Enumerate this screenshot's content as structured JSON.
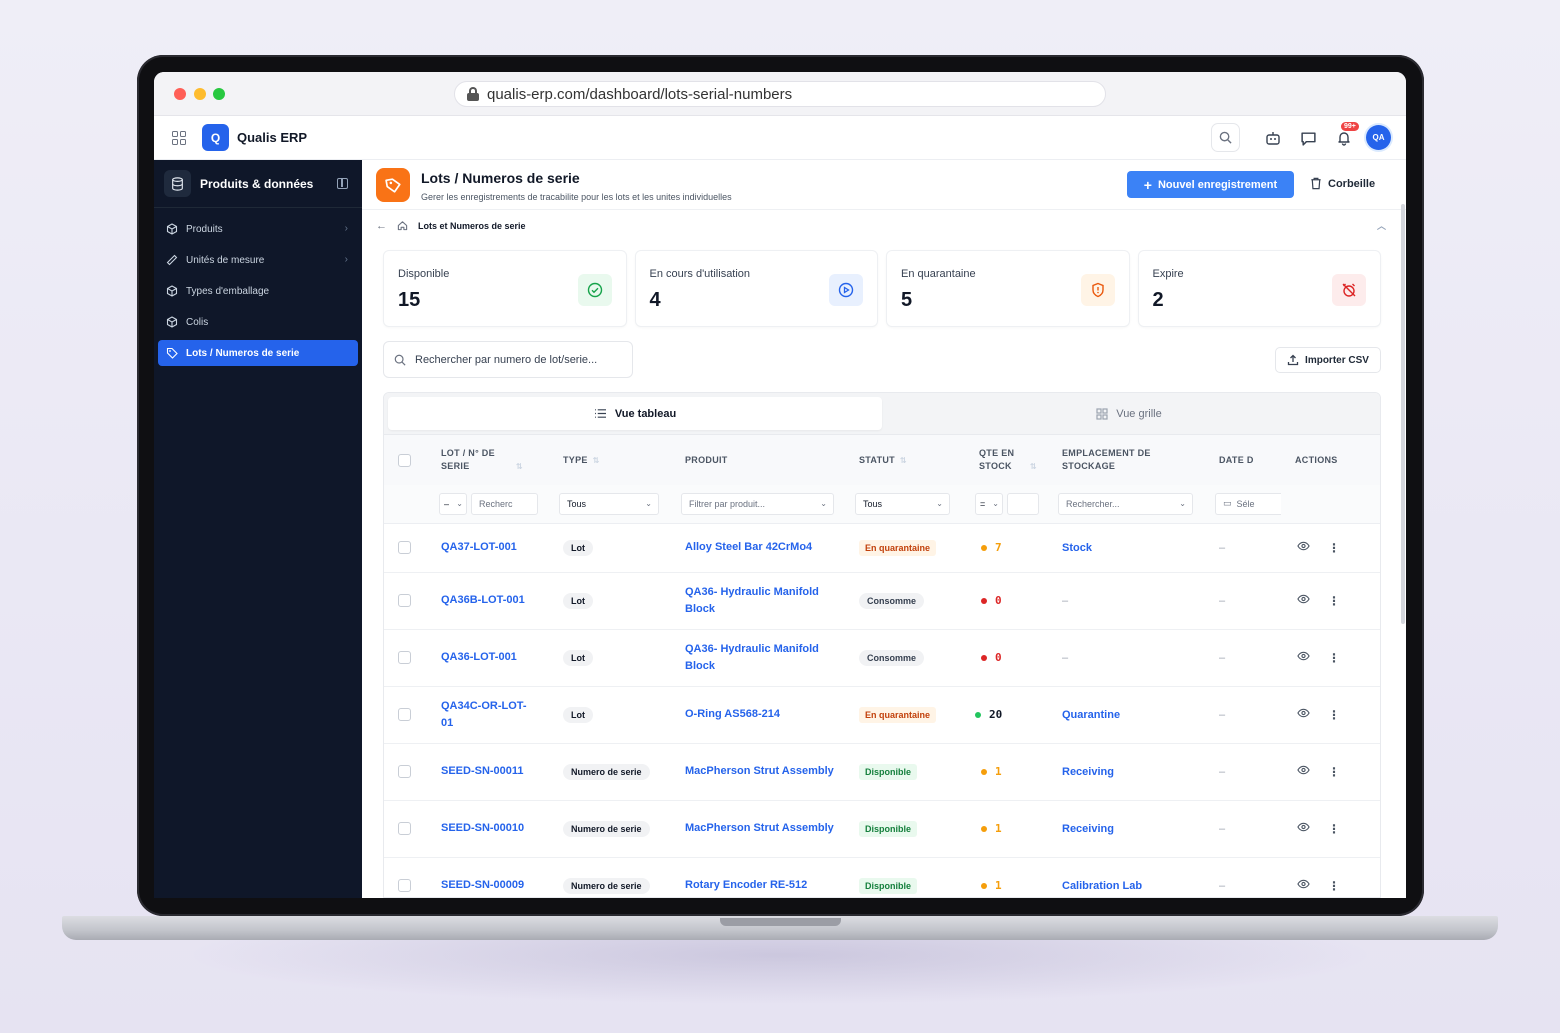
{
  "browser": {
    "url": "qualis-erp.com/dashboard/lots-serial-numbers"
  },
  "header": {
    "logo_letter": "Q",
    "app_name": "Qualis ERP",
    "notif_badge": "99+",
    "avatar_initials": "QA"
  },
  "sidebar": {
    "section_title": "Produits & données",
    "items": [
      {
        "label": "Produits",
        "has_chevron": true
      },
      {
        "label": "Unités de mesure",
        "has_chevron": true
      },
      {
        "label": "Types d'emballage",
        "has_chevron": false
      },
      {
        "label": "Colis",
        "has_chevron": false
      },
      {
        "label": "Lots / Numeros de serie",
        "has_chevron": false,
        "active": true
      }
    ]
  },
  "page": {
    "title": "Lots / Numeros de serie",
    "subtitle": "Gerer les enregistrements de tracabilite pour les lots et les unites individuelles",
    "new_button": "Nouvel enregistrement",
    "trash_button": "Corbeille",
    "breadcrumb": "Lots et Numeros de serie"
  },
  "stats": [
    {
      "label": "Disponible",
      "value": "15",
      "icon": "check-circle-icon",
      "color": "#16a34a",
      "bg": "#e9f9ee"
    },
    {
      "label": "En cours d'utilisation",
      "value": "4",
      "icon": "play-circle-icon",
      "color": "#2563eb",
      "bg": "#e8f0fe"
    },
    {
      "label": "En quarantaine",
      "value": "5",
      "icon": "shield-alert-icon",
      "color": "#ea580c",
      "bg": "#fff4e6"
    },
    {
      "label": "Expire",
      "value": "2",
      "icon": "alarm-off-icon",
      "color": "#dc2626",
      "bg": "#fdecec"
    }
  ],
  "search": {
    "placeholder": "Rechercher par numero de lot/serie..."
  },
  "import_button": "Importer CSV",
  "views": {
    "table": "Vue tableau",
    "grid": "Vue grille"
  },
  "table": {
    "headers": {
      "lot": "LOT / N° DE SERIE",
      "type": "TYPE",
      "product": "PRODUIT",
      "status": "STATUT",
      "qty": "QTE EN STOCK",
      "location": "EMPLACEMENT DE STOCKAGE",
      "date": "DATE D",
      "actions": "ACTIONS"
    },
    "filters": {
      "lot_op": "–",
      "lot_search": "Recherc",
      "type": "Tous",
      "product": "Filtrer par produit...",
      "status": "Tous",
      "qty_op": "=",
      "location": "Rechercher...",
      "date": "Séle"
    },
    "rows": [
      {
        "lot": "QA37-LOT-001",
        "type": "Lot",
        "product": "Alloy Steel Bar 42CrMo4",
        "status": "En quarantaine",
        "status_kind": "quar",
        "qty": "7",
        "qty_kind": "orange",
        "location": "Stock",
        "date": "–"
      },
      {
        "lot": "QA36B-LOT-001",
        "type": "Lot",
        "product": "QA36- Hydraulic Manifold Block",
        "status": "Consomme",
        "status_kind": "cons",
        "qty": "0",
        "qty_kind": "red",
        "location": "–",
        "date": "–"
      },
      {
        "lot": "QA36-LOT-001",
        "type": "Lot",
        "product": "QA36- Hydraulic Manifold Block",
        "status": "Consomme",
        "status_kind": "cons",
        "qty": "0",
        "qty_kind": "red",
        "location": "–",
        "date": "–"
      },
      {
        "lot": "QA34C-OR-LOT-01",
        "type": "Lot",
        "product": "O-Ring AS568-214",
        "status": "En quarantaine",
        "status_kind": "quar",
        "qty": "20",
        "qty_kind": "green",
        "location": "Quarantine",
        "date": "–"
      },
      {
        "lot": "SEED-SN-00011",
        "type": "Numero de serie",
        "product": "MacPherson Strut Assembly",
        "status": "Disponible",
        "status_kind": "disp",
        "qty": "1",
        "qty_kind": "orange",
        "location": "Receiving",
        "date": "–"
      },
      {
        "lot": "SEED-SN-00010",
        "type": "Numero de serie",
        "product": "MacPherson Strut Assembly",
        "status": "Disponible",
        "status_kind": "disp",
        "qty": "1",
        "qty_kind": "orange",
        "location": "Receiving",
        "date": "–"
      },
      {
        "lot": "SEED-SN-00009",
        "type": "Numero de serie",
        "product": "Rotary Encoder RE-512",
        "status": "Disponible",
        "status_kind": "disp",
        "qty": "1",
        "qty_kind": "orange",
        "location": "Calibration Lab",
        "date": "–"
      }
    ]
  }
}
